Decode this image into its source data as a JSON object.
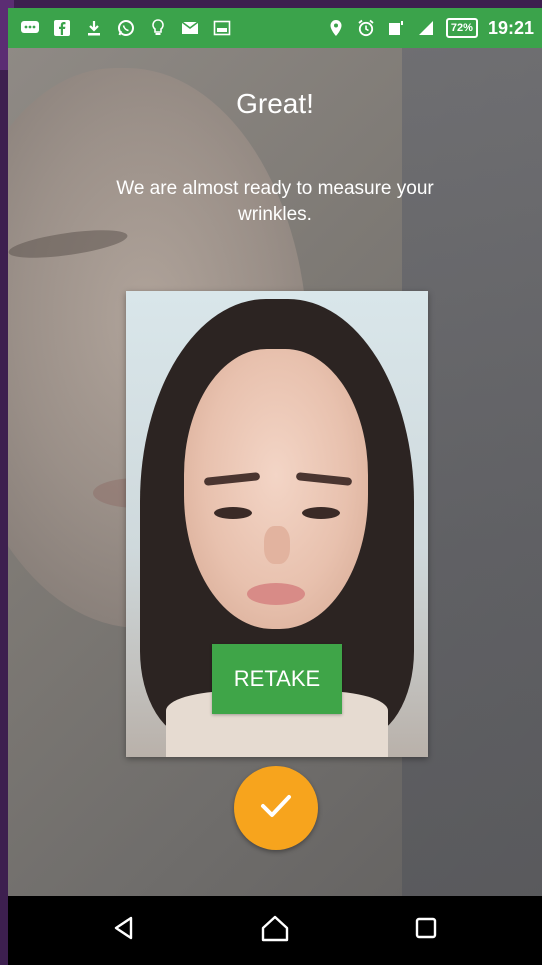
{
  "status_bar": {
    "time": "19:21",
    "battery": "72%",
    "colors": {
      "background": "#3ba34b",
      "foreground": "#ffffff"
    },
    "left_icons": [
      "messages-icon",
      "facebook-icon",
      "download-icon",
      "whatsapp-icon",
      "lightbulb-icon",
      "gmail-icon",
      "image-icon"
    ],
    "right_icons": [
      "location-icon",
      "alarm-icon",
      "data-icon",
      "signal-icon"
    ]
  },
  "screen": {
    "title": "Great!",
    "subtitle": "We are almost ready to measure your wrinkles."
  },
  "actions": {
    "retake_label": "RETAKE",
    "confirm_icon": "check-icon"
  },
  "nav": {
    "back_icon": "back-triangle-icon",
    "home_icon": "home-icon",
    "recents_icon": "recents-square-icon"
  },
  "colors": {
    "accent_green": "#3fa548",
    "confirm_orange": "#f7a41d"
  }
}
